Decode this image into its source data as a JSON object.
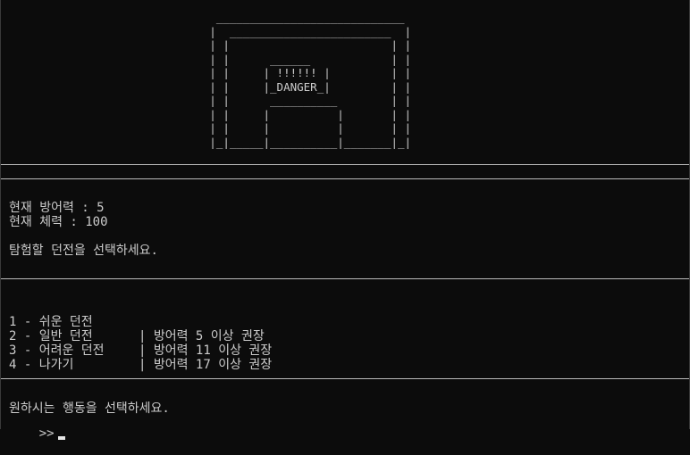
{
  "banner_art": "                                ____________________________\n                               |  ________________________  |\n                               | |                        | |\n                               | |      ______            | |\n                               | |     | !!!!!! |         | |\n                               | |     |_DANGER_|         | |\n                               | |      __________        | |\n                               | |     |          |       | |\n                               | |     |          |       | |\n                               |_|_____|__________|_______|_|",
  "status": {
    "defense": "현재 방어력 : 5",
    "hp": "현재 체력 : 100"
  },
  "instruction": "탐험할 던전을 선택하세요.",
  "menu": [
    {
      "option": "1 - 쉬운 던전",
      "requirement": "| 방어력 5 이상 권장"
    },
    {
      "option": "2 - 일반 던전",
      "requirement": "| 방어력 11 이상 권장"
    },
    {
      "option": "3 - 어려운 던전",
      "requirement": "| 방어력 17 이상 권장"
    },
    {
      "option": "4 - 나가기",
      "requirement": ""
    }
  ],
  "action_prompt": "원하시는 행동을 선택하세요.",
  "input_prompt": ">>",
  "colors": {
    "background": "#0c0c0c",
    "text": "#cccccc",
    "rule": "#bcbcbc"
  }
}
